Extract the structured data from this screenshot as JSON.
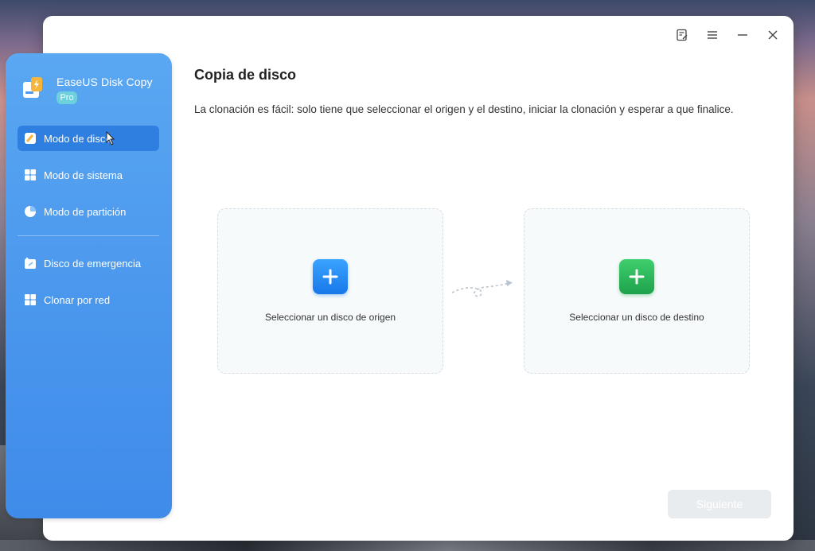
{
  "app": {
    "name": "EaseUS Disk Copy",
    "edition_badge": "Pro"
  },
  "titlebar": {
    "icons": [
      "feedback-icon",
      "menu-icon",
      "minimize-icon",
      "close-icon"
    ]
  },
  "sidebar": {
    "items": [
      {
        "label": "Modo de disco",
        "icon": "disk-mode-icon",
        "active": true
      },
      {
        "label": "Modo de sistema",
        "icon": "windows-icon",
        "active": false
      },
      {
        "label": "Modo de partición",
        "icon": "pie-partition-icon",
        "active": false
      },
      {
        "label": "Disco de emergencia",
        "icon": "emergency-disk-icon",
        "active": false
      },
      {
        "label": "Clonar por red",
        "icon": "network-clone-icon",
        "active": false
      }
    ]
  },
  "main": {
    "title": "Copia de disco",
    "description": "La clonación es fácil: solo tiene que seleccionar el origen y el destino, iniciar la clonación y esperar a que finalice.",
    "source_card": {
      "label": "Seleccionar un disco de origen",
      "icon": "plus-icon"
    },
    "target_card": {
      "label": "Seleccionar un disco de destino",
      "icon": "plus-icon"
    },
    "next_button": "Siguiente"
  },
  "colors": {
    "sidebar_gradient_top": "#5aa7f2",
    "sidebar_active": "#2f7fe0",
    "source_accent": "#1778e8",
    "target_accent": "#1ea14b",
    "disabled_button": "#e9ecef"
  }
}
